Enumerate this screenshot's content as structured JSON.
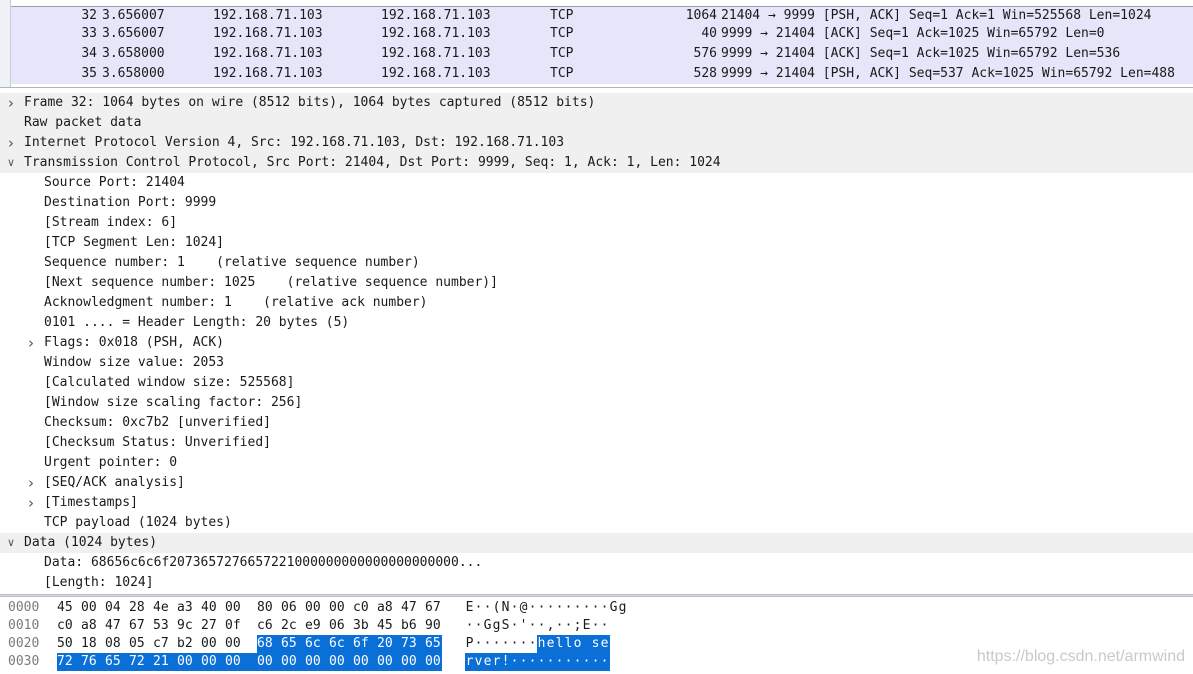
{
  "packet_list": {
    "rows": [
      {
        "no": "32",
        "time": "3.656007",
        "src": "192.168.71.103",
        "dst": "192.168.71.103",
        "proto": "TCP",
        "len": "1064",
        "info": "21404 → 9999 [PSH, ACK] Seq=1 Ack=1 Win=525568 Len=1024",
        "selected": true
      },
      {
        "no": "33",
        "time": "3.656007",
        "src": "192.168.71.103",
        "dst": "192.168.71.103",
        "proto": "TCP",
        "len": "40",
        "info": "9999 → 21404 [ACK] Seq=1 Ack=1025 Win=65792 Len=0",
        "selected": false
      },
      {
        "no": "34",
        "time": "3.658000",
        "src": "192.168.71.103",
        "dst": "192.168.71.103",
        "proto": "TCP",
        "len": "576",
        "info": "9999 → 21404 [ACK] Seq=1 Ack=1025 Win=65792 Len=536",
        "selected": false
      },
      {
        "no": "35",
        "time": "3.658000",
        "src": "192.168.71.103",
        "dst": "192.168.71.103",
        "proto": "TCP",
        "len": "528",
        "info": "9999 → 21404 [PSH, ACK] Seq=537 Ack=1025 Win=65792 Len=488",
        "selected": false
      }
    ]
  },
  "details": {
    "rows": [
      {
        "level": 0,
        "arrow": "collapsed",
        "text": "Frame 32: 1064 bytes on wire (8512 bits), 1064 bytes captured (8512 bits)"
      },
      {
        "level": 0,
        "arrow": "none",
        "text": "Raw packet data"
      },
      {
        "level": 0,
        "arrow": "collapsed",
        "text": "Internet Protocol Version 4, Src: 192.168.71.103, Dst: 192.168.71.103"
      },
      {
        "level": 0,
        "arrow": "expanded",
        "text": "Transmission Control Protocol, Src Port: 21404, Dst Port: 9999, Seq: 1, Ack: 1, Len: 1024"
      },
      {
        "level": 1,
        "arrow": "none",
        "text": "Source Port: 21404"
      },
      {
        "level": 1,
        "arrow": "none",
        "text": "Destination Port: 9999"
      },
      {
        "level": 1,
        "arrow": "none",
        "text": "[Stream index: 6]"
      },
      {
        "level": 1,
        "arrow": "none",
        "text": "[TCP Segment Len: 1024]"
      },
      {
        "level": 1,
        "arrow": "none",
        "text": "Sequence number: 1    (relative sequence number)"
      },
      {
        "level": 1,
        "arrow": "none",
        "text": "[Next sequence number: 1025    (relative sequence number)]"
      },
      {
        "level": 1,
        "arrow": "none",
        "text": "Acknowledgment number: 1    (relative ack number)"
      },
      {
        "level": 1,
        "arrow": "none",
        "text": "0101 .... = Header Length: 20 bytes (5)"
      },
      {
        "level": 1,
        "arrow": "collapsed",
        "text": "Flags: 0x018 (PSH, ACK)"
      },
      {
        "level": 1,
        "arrow": "none",
        "text": "Window size value: 2053"
      },
      {
        "level": 1,
        "arrow": "none",
        "text": "[Calculated window size: 525568]"
      },
      {
        "level": 1,
        "arrow": "none",
        "text": "[Window size scaling factor: 256]"
      },
      {
        "level": 1,
        "arrow": "none",
        "text": "Checksum: 0xc7b2 [unverified]"
      },
      {
        "level": 1,
        "arrow": "none",
        "text": "[Checksum Status: Unverified]"
      },
      {
        "level": 1,
        "arrow": "none",
        "text": "Urgent pointer: 0"
      },
      {
        "level": 1,
        "arrow": "collapsed",
        "text": "[SEQ/ACK analysis]"
      },
      {
        "level": 1,
        "arrow": "collapsed",
        "text": "[Timestamps]"
      },
      {
        "level": 1,
        "arrow": "none",
        "text": "TCP payload (1024 bytes)"
      },
      {
        "level": 0,
        "arrow": "expanded",
        "text": "Data (1024 bytes)"
      },
      {
        "level": 1,
        "arrow": "none",
        "text": "Data: 68656c6c6f2073657276657221000000000000000000000..."
      },
      {
        "level": 1,
        "arrow": "none",
        "text": "[Length: 1024]"
      }
    ]
  },
  "hex_dump": {
    "rows": [
      {
        "offset": "0000",
        "bytes": [
          "45",
          "00",
          "04",
          "28",
          "4e",
          "a3",
          "40",
          "00",
          "80",
          "06",
          "00",
          "00",
          "c0",
          "a8",
          "47",
          "67"
        ],
        "ascii": "E··(N·@·········Gg",
        "hl_from": -1
      },
      {
        "offset": "0010",
        "bytes": [
          "c0",
          "a8",
          "47",
          "67",
          "53",
          "9c",
          "27",
          "0f",
          "c6",
          "2c",
          "e9",
          "06",
          "3b",
          "45",
          "b6",
          "90"
        ],
        "ascii": "··GgS·'··,··;E··",
        "hl_from": -1
      },
      {
        "offset": "0020",
        "bytes": [
          "50",
          "18",
          "08",
          "05",
          "c7",
          "b2",
          "00",
          "00",
          "68",
          "65",
          "6c",
          "6c",
          "6f",
          "20",
          "73",
          "65"
        ],
        "ascii": "P·······hello se",
        "hl_from": 8
      },
      {
        "offset": "0030",
        "bytes": [
          "72",
          "76",
          "65",
          "72",
          "21",
          "00",
          "00",
          "00",
          "00",
          "00",
          "00",
          "00",
          "00",
          "00",
          "00",
          "00"
        ],
        "ascii": "rver!···········",
        "hl_from": 0
      }
    ]
  },
  "watermark": "https://blog.csdn.net/armwind",
  "colors": {
    "row_bg": "#e6e6fa",
    "highlight": "#0a6fd6",
    "tree_top_bg": "#f0f0f0"
  }
}
